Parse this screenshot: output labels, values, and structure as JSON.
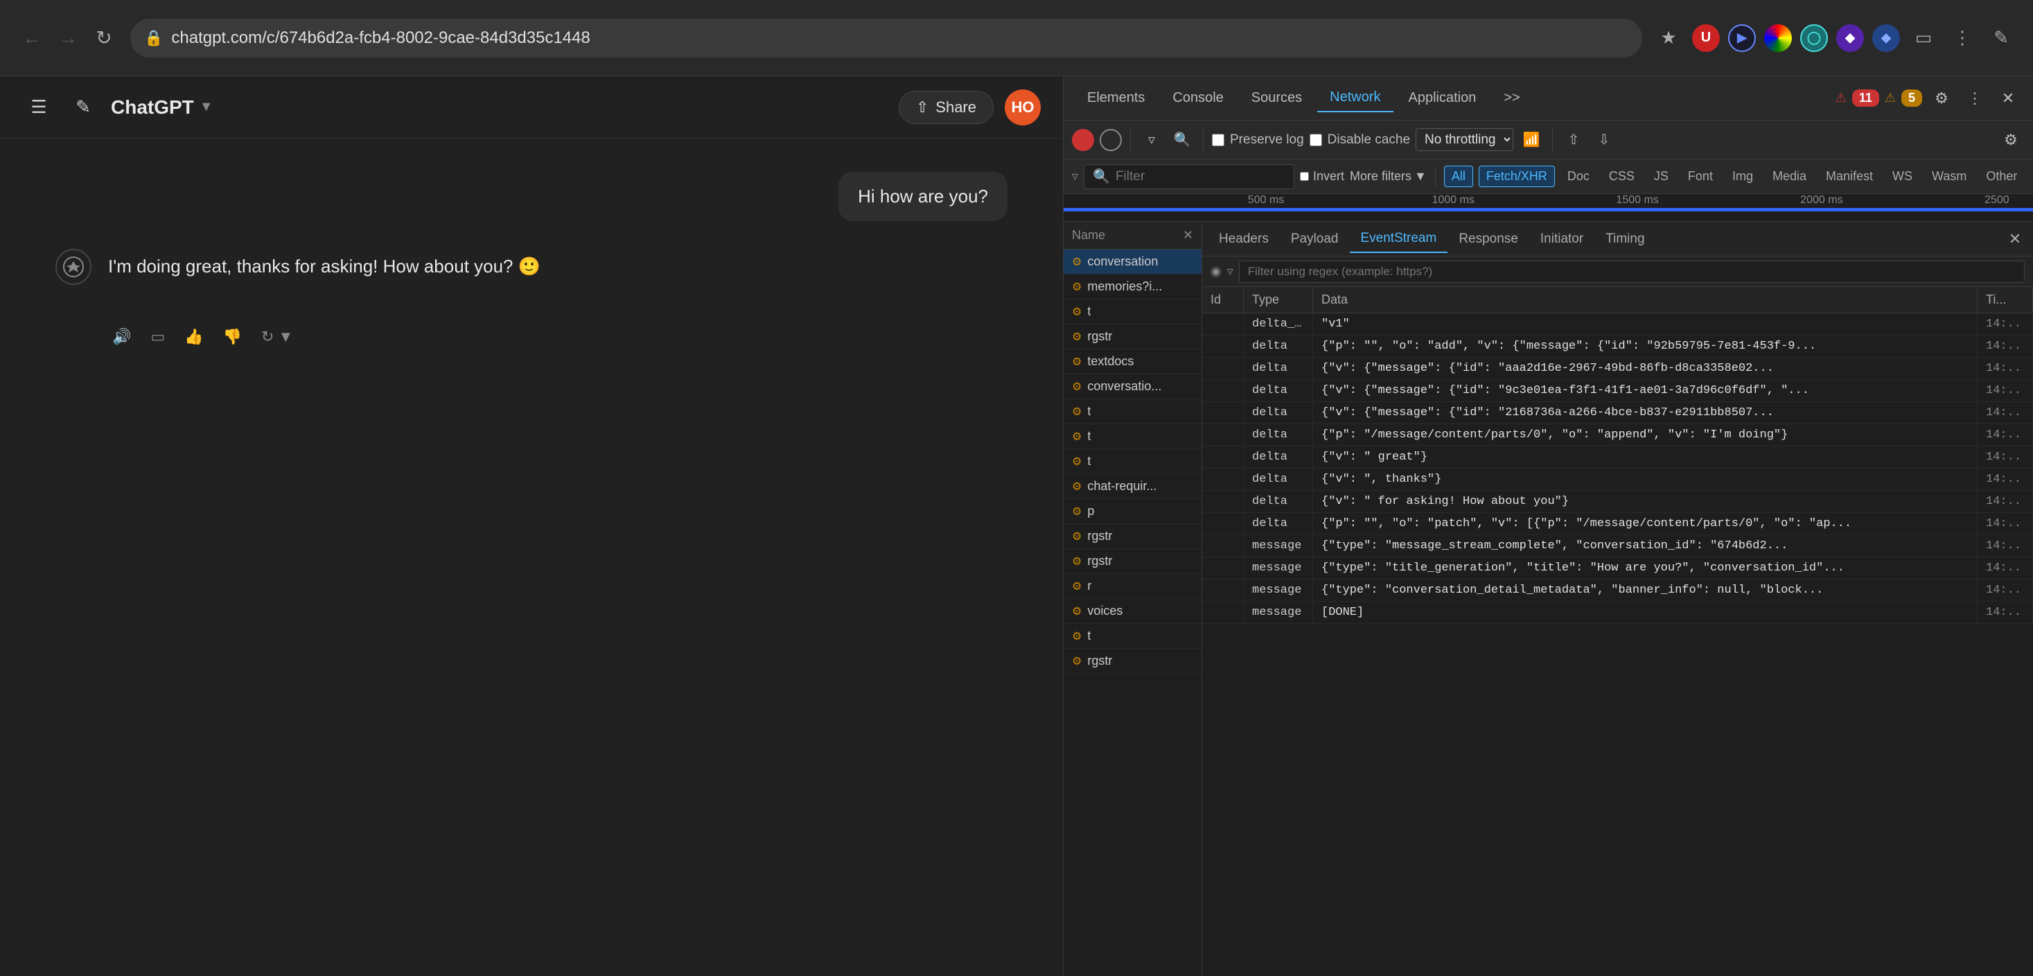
{
  "browser": {
    "url": "chatgpt.com/c/674b6d2a-fcb4-8002-9cae-84d3d35c1448",
    "back_btn": "←",
    "forward_btn": "→",
    "reload_btn": "↻"
  },
  "chat": {
    "title": "ChatGPT",
    "share_label": "Share",
    "user_initials": "HO",
    "user_message": "Hi how are you?",
    "assistant_message": "I'm doing great, thanks for asking! How about you? 🙂"
  },
  "devtools": {
    "tabs": [
      "Elements",
      "Console",
      "Sources",
      "Network",
      "Application",
      ">>"
    ],
    "active_tab": "Network",
    "error_count": "11",
    "warn_count": "5",
    "toolbar": {
      "preserve_log": "Preserve log",
      "disable_cache": "Disable cache",
      "throttle": "No throttling"
    },
    "filter_bar": {
      "filter_placeholder": "Filter",
      "invert_label": "Invert",
      "more_filters": "More filters",
      "types": [
        "All",
        "Fetch/XHR",
        "Doc",
        "CSS",
        "JS",
        "Font",
        "Img",
        "Media",
        "Manifest",
        "WS",
        "Wasm",
        "Other"
      ],
      "active_type": "Fetch/XHR"
    },
    "timeline": {
      "labels": [
        "500 ms",
        "1000 ms",
        "1500 ms",
        "2000 ms",
        "2500"
      ]
    },
    "network_list": {
      "header_label": "Name",
      "items": [
        {
          "name": "conversation",
          "icon": "⚙"
        },
        {
          "name": "memories?i...",
          "icon": "⚙"
        },
        {
          "name": "t",
          "icon": "⚙"
        },
        {
          "name": "rgstr",
          "icon": "⚙"
        },
        {
          "name": "textdocs",
          "icon": "⚙"
        },
        {
          "name": "conversatio...",
          "icon": "⚙"
        },
        {
          "name": "t",
          "icon": "⚙"
        },
        {
          "name": "t",
          "icon": "⚙"
        },
        {
          "name": "t",
          "icon": "⚙"
        },
        {
          "name": "chat-requir...",
          "icon": "⚙"
        },
        {
          "name": "p",
          "icon": "⚙"
        },
        {
          "name": "rgstr",
          "icon": "⚙"
        },
        {
          "name": "rgstr",
          "icon": "⚙"
        },
        {
          "name": "r",
          "icon": "⚙"
        },
        {
          "name": "voices",
          "icon": "⚙"
        },
        {
          "name": "t",
          "icon": "⚙"
        },
        {
          "name": "rgstr",
          "icon": "⚙"
        }
      ]
    },
    "detail": {
      "tabs": [
        "Headers",
        "Payload",
        "EventStream",
        "Response",
        "Initiator",
        "Timing"
      ],
      "active_tab": "EventStream",
      "columns": [
        "Id",
        "Type",
        "Data",
        "Ti..."
      ],
      "rows": [
        {
          "id": "",
          "type": "delta_enc...",
          "data": "\"v1\"",
          "time": "14:.."
        },
        {
          "id": "",
          "type": "delta",
          "data": "{\"p\": \"\", \"o\": \"add\", \"v\": {\"message\": {\"id\": \"92b59795-7e81-453f-9...",
          "time": "14:.."
        },
        {
          "id": "",
          "type": "delta",
          "data": "{\"v\": {\"message\": {\"id\": \"aaa2d16e-2967-49bd-86fb-d8ca3358e02...",
          "time": "14:.."
        },
        {
          "id": "",
          "type": "delta",
          "data": "{\"v\": {\"message\": {\"id\": \"9c3e01ea-f3f1-41f1-ae01-3a7d96c0f6df\", \"...",
          "time": "14:.."
        },
        {
          "id": "",
          "type": "delta",
          "data": "{\"v\": {\"message\": {\"id\": \"2168736a-a266-4bce-b837-e2911bb8507...",
          "time": "14:.."
        },
        {
          "id": "",
          "type": "delta",
          "data": "{\"p\": \"/message/content/parts/0\", \"o\": \"append\", \"v\": \"I'm doing\"}",
          "time": "14:.."
        },
        {
          "id": "",
          "type": "delta",
          "data": "{\"v\": \" great\"}",
          "time": "14:.."
        },
        {
          "id": "",
          "type": "delta",
          "data": "{\"v\": \", thanks\"}",
          "time": "14:.."
        },
        {
          "id": "",
          "type": "delta",
          "data": "{\"v\": \" for asking! How about you\"}",
          "time": "14:.."
        },
        {
          "id": "",
          "type": "delta",
          "data": "{\"p\": \"\", \"o\": \"patch\", \"v\": [{\"p\": \"/message/content/parts/0\", \"o\": \"ap...",
          "time": "14:.."
        },
        {
          "id": "",
          "type": "message",
          "data": "{\"type\": \"message_stream_complete\", \"conversation_id\": \"674b6d2...",
          "time": "14:.."
        },
        {
          "id": "",
          "type": "message",
          "data": "{\"type\": \"title_generation\", \"title\": \"How are you?\", \"conversation_id\"...",
          "time": "14:.."
        },
        {
          "id": "",
          "type": "message",
          "data": "{\"type\": \"conversation_detail_metadata\", \"banner_info\": null, \"block...",
          "time": "14:.."
        },
        {
          "id": "",
          "type": "message",
          "data": "[DONE]",
          "time": "14:.."
        }
      ]
    }
  }
}
